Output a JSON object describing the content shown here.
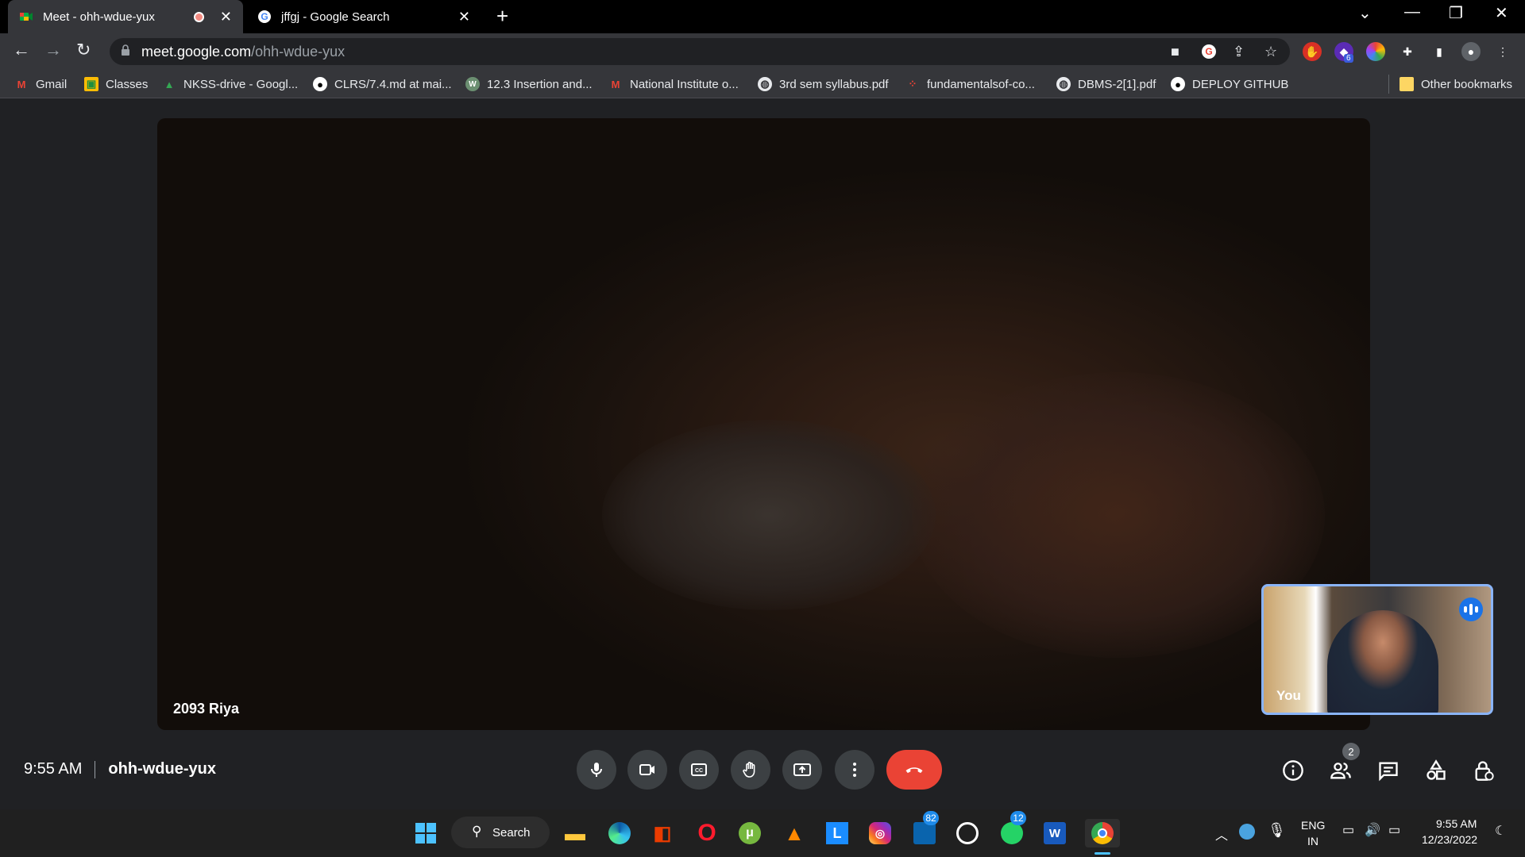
{
  "browser": {
    "tabs": [
      {
        "title": "Meet - ohh-wdue-yux",
        "active": true,
        "recording": true
      },
      {
        "title": "jffgj - Google Search",
        "active": false
      }
    ],
    "url_host": "meet.google.com",
    "url_path": "/ohh-wdue-yux",
    "bookmarks": [
      {
        "label": "Gmail",
        "icon": "gmail-icon"
      },
      {
        "label": "Classes",
        "icon": "classroom-icon"
      },
      {
        "label": "NKSS-drive - Googl...",
        "icon": "drive-icon"
      },
      {
        "label": "CLRS/7.4.md at mai...",
        "icon": "github-icon"
      },
      {
        "label": "12.3 Insertion and...",
        "icon": "w-site-icon"
      },
      {
        "label": "National Institute o...",
        "icon": "gmail-icon"
      },
      {
        "label": "3rd sem syllabus.pdf",
        "icon": "globe-icon"
      },
      {
        "label": "fundamentalsof-co...",
        "icon": "dots-icon"
      },
      {
        "label": "DBMS-2[1].pdf",
        "icon": "globe-icon"
      },
      {
        "label": "DEPLOY GITHUB",
        "icon": "github-icon"
      }
    ],
    "other_bookmarks": "Other bookmarks",
    "extension_badge": "6"
  },
  "meet": {
    "remote_participant": "2093 Riya",
    "self_label": "You",
    "time": "9:55 AM",
    "meeting_code": "ohh-wdue-yux",
    "participant_count": "2",
    "accent_color": "#8ab4f8",
    "hangup_color": "#ea4335"
  },
  "taskbar": {
    "search_label": "Search",
    "badges": {
      "outlook": "82",
      "whatsapp": "12"
    },
    "language": "ENG",
    "region": "IN",
    "clock_time": "9:55 AM",
    "clock_date": "12/23/2022"
  }
}
